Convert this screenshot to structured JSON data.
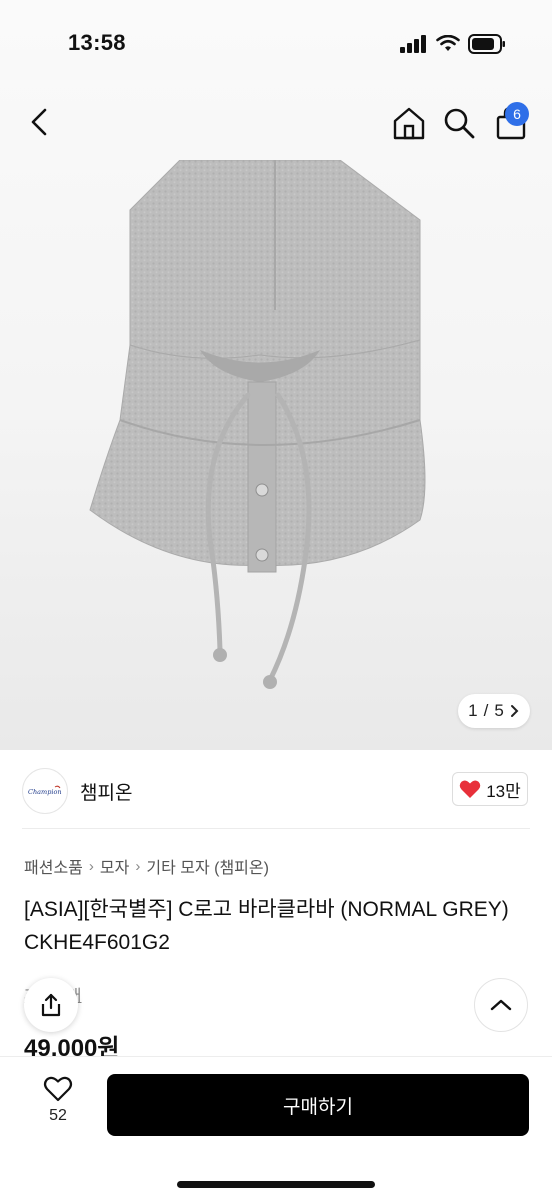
{
  "status_bar": {
    "time": "13:58"
  },
  "nav": {
    "cart_count": "6"
  },
  "gallery": {
    "current": "1",
    "separator": "/",
    "total": "5"
  },
  "brand": {
    "name": "챔피온",
    "logo_text": "Champion"
  },
  "likes": {
    "count": "13만"
  },
  "breadcrumb": [
    "패션소품",
    "모자",
    "기타 모자 (챔피온)"
  ],
  "product": {
    "title": "[ASIA][한국별주] C로고 바라클라바 (NORMAL GREY) CKHE4F601G2",
    "reviews": "후기 3개",
    "price": "49,000원"
  },
  "bottom": {
    "wish_count": "52",
    "buy_label": "구매하기"
  },
  "colors": {
    "buy_button": "#000000",
    "badge": "#2f6fe8",
    "heart": "#e8303a"
  }
}
